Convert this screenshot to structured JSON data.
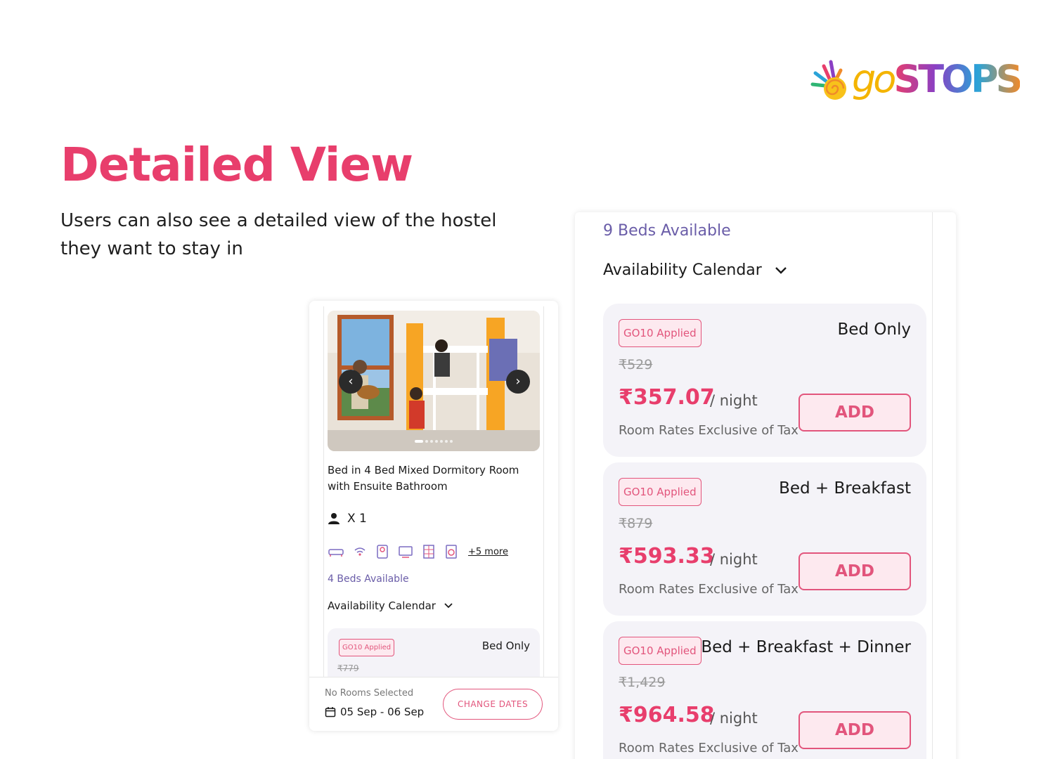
{
  "logo": {
    "text_a": "go",
    "text_b": "STOPS"
  },
  "hero": {
    "title": "Detailed View",
    "subtitle": "Users can also see a detailed view of the hostel they want to stay in"
  },
  "colors": {
    "accent": "#e83e6c",
    "purple": "#6a5da8",
    "card_bg": "#f4f3f8"
  },
  "mobile": {
    "photo": {
      "prev_icon": "‹",
      "next_icon": "›",
      "slide_count": 8,
      "active_slide": 1
    },
    "room_name": "Bed in 4 Bed Mixed Dormitory Room with Ensuite Bathroom",
    "guests": "X 1",
    "amenity_icons": [
      "sofa-icon",
      "wifi-icon",
      "keycard-icon",
      "tv-icon",
      "locker-icon",
      "washing-machine-icon"
    ],
    "more_link": "+5 more",
    "beds_available": "4 Beds Available",
    "availability_calendar": "Availability Calendar",
    "rate": {
      "badge": "GO10 Applied",
      "plan": "Bed Only",
      "old_price": "₹779"
    },
    "footer": {
      "status": "No Rooms Selected",
      "dates": "05 Sep - 06 Sep",
      "change_button": "CHANGE DATES"
    }
  },
  "detail_panel": {
    "beds_available": "9 Beds Available",
    "availability_calendar": "Availability Calendar",
    "rates": [
      {
        "badge": "GO10 Applied",
        "plan": "Bed Only",
        "old_price": "₹529",
        "price": "₹357.07",
        "per": "/ night",
        "tax_note": "Room Rates Exclusive of Tax",
        "add_label": "ADD"
      },
      {
        "badge": "GO10 Applied",
        "plan": "Bed + Breakfast",
        "old_price": "₹879",
        "price": "₹593.33",
        "per": "/ night",
        "tax_note": "Room Rates Exclusive of Tax",
        "add_label": "ADD"
      },
      {
        "badge": "GO10 Applied",
        "plan": "Bed + Breakfast + Dinner",
        "old_price": "₹1,429",
        "price": "₹964.58",
        "per": "/ night",
        "tax_note": "Room Rates Exclusive of Tax",
        "add_label": "ADD"
      }
    ]
  }
}
